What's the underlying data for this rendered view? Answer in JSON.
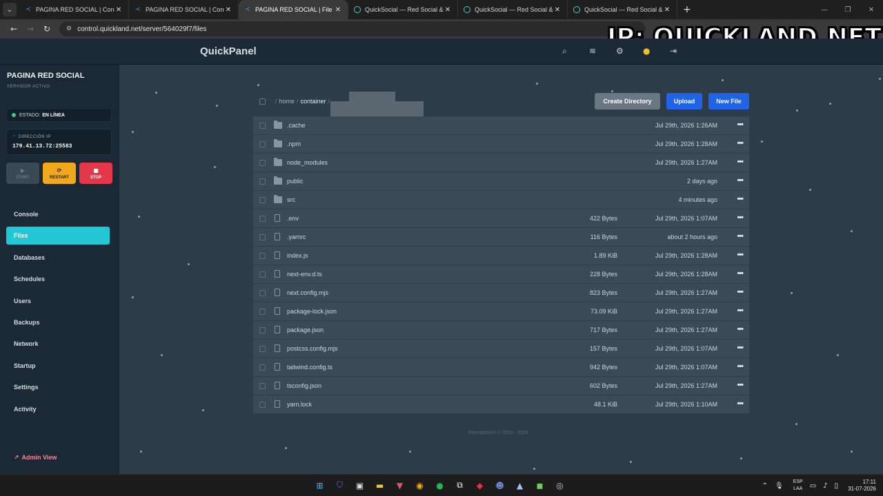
{
  "browser": {
    "tabs": [
      {
        "label": "PAGINA RED SOCIAL | Console",
        "icon": "pterodactyl-icon",
        "active": false
      },
      {
        "label": "PAGINA RED SOCIAL | Console",
        "icon": "pterodactyl-icon",
        "active": false
      },
      {
        "label": "PAGINA RED SOCIAL | File Mana",
        "icon": "pterodactyl-icon",
        "active": true
      },
      {
        "label": "QuickSocial — Red Social & Co",
        "icon": "quicksocial-icon",
        "active": false
      },
      {
        "label": "QuickSocial — Red Social & Co",
        "icon": "quicksocial-icon",
        "active": false
      },
      {
        "label": "QuickSocial — Red Social & Co",
        "icon": "quicksocial-icon",
        "active": false
      }
    ],
    "new_tab": "+",
    "url": "control.quickland.net/server/564029f7/files"
  },
  "overlay": {
    "text": "IP: QUICKLAND.NET"
  },
  "header": {
    "brand": "QuickPanel"
  },
  "sidebar": {
    "server_name": "PAGINA RED SOCIAL",
    "server_sub": "SERVIDOR ACTIVO",
    "status_label": "ESTADO:",
    "status_value": "EN LÍNEA",
    "ip_label": "DIRECCIÓN IP",
    "ip_value": "179.41.13.72:25583",
    "power": {
      "start": "START",
      "restart": "RESTART",
      "stop": "STOP"
    },
    "nav": [
      {
        "label": "Console",
        "active": false
      },
      {
        "label": "Files",
        "active": true
      },
      {
        "label": "Databases",
        "active": false
      },
      {
        "label": "Schedules",
        "active": false
      },
      {
        "label": "Users",
        "active": false
      },
      {
        "label": "Backups",
        "active": false
      },
      {
        "label": "Network",
        "active": false
      },
      {
        "label": "Startup",
        "active": false
      },
      {
        "label": "Settings",
        "active": false
      },
      {
        "label": "Activity",
        "active": false
      }
    ],
    "admin_view": "Admin View"
  },
  "files": {
    "breadcrumb": {
      "sep": "/",
      "home": "home",
      "container": "container"
    },
    "buttons": {
      "create_directory": "Create Directory",
      "upload": "Upload",
      "new_file": "New File"
    },
    "rows": [
      {
        "name": ".cache",
        "type": "folder",
        "size": "",
        "date": "Jul 29th, 2026 1:26AM"
      },
      {
        "name": ".npm",
        "type": "folder",
        "size": "",
        "date": "Jul 29th, 2026 1:28AM"
      },
      {
        "name": "node_modules",
        "type": "folder",
        "size": "",
        "date": "Jul 29th, 2026 1:27AM"
      },
      {
        "name": "public",
        "type": "folder",
        "size": "",
        "date": "2 days ago"
      },
      {
        "name": "src",
        "type": "folder",
        "size": "",
        "date": "4 minutes ago"
      },
      {
        "name": ".env",
        "type": "file",
        "size": "422 Bytes",
        "date": "Jul 29th, 2026 1:07AM"
      },
      {
        "name": ".yarnrc",
        "type": "file",
        "size": "116 Bytes",
        "date": "about 2 hours ago"
      },
      {
        "name": "index.js",
        "type": "file",
        "size": "1.89 KiB",
        "date": "Jul 29th, 2026 1:28AM"
      },
      {
        "name": "next-env.d.ts",
        "type": "file",
        "size": "228 Bytes",
        "date": "Jul 29th, 2026 1:28AM"
      },
      {
        "name": "next.config.mjs",
        "type": "file",
        "size": "823 Bytes",
        "date": "Jul 29th, 2026 1:27AM"
      },
      {
        "name": "package-lock.json",
        "type": "file",
        "size": "73.09 KiB",
        "date": "Jul 29th, 2026 1:27AM"
      },
      {
        "name": "package.json",
        "type": "file",
        "size": "717 Bytes",
        "date": "Jul 29th, 2026 1:27AM"
      },
      {
        "name": "postcss.config.mjs",
        "type": "file",
        "size": "157 Bytes",
        "date": "Jul 29th, 2026 1:07AM"
      },
      {
        "name": "tailwind.config.ts",
        "type": "file",
        "size": "942 Bytes",
        "date": "Jul 29th, 2026 1:07AM"
      },
      {
        "name": "tsconfig.json",
        "type": "file",
        "size": "602 Bytes",
        "date": "Jul 29th, 2026 1:27AM"
      },
      {
        "name": "yarn.lock",
        "type": "file",
        "size": "48.1 KiB",
        "date": "Jul 29th, 2026 1:10AM"
      }
    ],
    "row_menu": "•••",
    "footer": "Pterodactyl® © 2015 - 2026"
  },
  "taskbar": {
    "lang_top": "ESP",
    "lang_bottom": "LAA",
    "time": "17:11",
    "date": "31-07-2026"
  },
  "colors": {
    "accent": "#23c6d4",
    "primary": "#2163e6",
    "online": "#35d07f",
    "restart": "#f0a81c",
    "stop": "#e2384a"
  }
}
